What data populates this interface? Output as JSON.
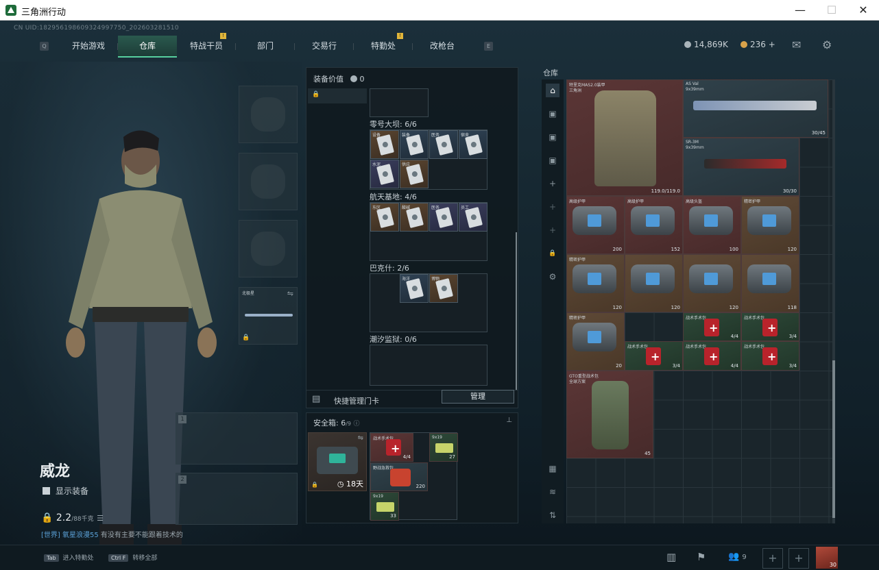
{
  "window": {
    "title": "三角洲行动",
    "min": "—",
    "max": "☐",
    "close": "✕"
  },
  "uid": "CN UID:182956198609324997750_202603281510",
  "nav": {
    "left_key": "Q",
    "right_key": "E",
    "tabs": [
      {
        "label": "开始游戏",
        "active": false,
        "badge": ""
      },
      {
        "label": "仓库",
        "active": true,
        "badge": ""
      },
      {
        "label": "特战干员",
        "active": false,
        "badge": "!"
      },
      {
        "label": "部门",
        "active": false,
        "badge": ""
      },
      {
        "label": "交易行",
        "active": false,
        "badge": ""
      },
      {
        "label": "特勤处",
        "active": false,
        "badge": "!"
      },
      {
        "label": "改枪台",
        "active": false,
        "badge": ""
      }
    ]
  },
  "currency": {
    "coins": "14,869K",
    "premium": "236 +"
  },
  "character": {
    "name": "威龙",
    "show_equipment": "显示装备",
    "weight": "2.2",
    "weight_unit": "/88千克",
    "melee_label": "北极星"
  },
  "chat": {
    "channel": "[世界]",
    "user": "氧星浪漫55",
    "text": "有没有主要不能跟着技术的"
  },
  "bottom": {
    "hint1_key": "Tab",
    "hint1": "进入特勤处",
    "hint2_key": "Ctrl F",
    "hint2": "转移全部",
    "friends": "9",
    "avatar_badge": "30"
  },
  "equip": {
    "title": "装备价值",
    "value": "0",
    "sections": [
      {
        "label": "零号大坝: 6/6"
      },
      {
        "label": "航天基地: 4/6"
      },
      {
        "label": "巴克什: 2/6"
      },
      {
        "label": "潮汐监狱: 0/6"
      }
    ],
    "cards_row1": [
      "设备",
      "装备",
      "医务",
      "宿舍"
    ],
    "cards_row2": [
      "水泥",
      "供应"
    ],
    "cards_row3": [
      "东区",
      "酸碱",
      "医务",
      "员工"
    ],
    "cards_row4": [
      "海洋",
      "博物"
    ],
    "keycard_label": "快捷管理门卡",
    "manage": "管理"
  },
  "safebox": {
    "title": "安全箱:",
    "count": "6",
    "cap": "/9",
    "timer": "18天",
    "items": [
      {
        "name": "战术手术包",
        "count": "4/4"
      },
      {
        "name": "9x19",
        "count": "27"
      },
      {
        "name": "野战急救包",
        "count": "220"
      },
      {
        "name": "9x19",
        "count": "33"
      }
    ]
  },
  "warehouse": {
    "title": "仓库",
    "items": [
      {
        "name": "特里克MAS2.0装甲",
        "sub": "三角洲",
        "count": "119.0/119.0",
        "color": "red"
      },
      {
        "name": "AS Val",
        "sub": "9x39mm",
        "count": "30/45",
        "color": "gray"
      },
      {
        "name": "SR-3M",
        "sub": "9x39mm",
        "count": "30/30",
        "color": "gray"
      },
      {
        "name": "高级护甲",
        "count": "200",
        "color": "red"
      },
      {
        "name": "高级护甲",
        "count": "152",
        "color": "red"
      },
      {
        "name": "高级头盔",
        "count": "100",
        "color": "red"
      },
      {
        "name": "精密护甲",
        "count": "120",
        "color": "gold"
      },
      {
        "name": "精密护甲",
        "count": "120",
        "color": "gold"
      },
      {
        "name": "",
        "count": "120",
        "color": "gold"
      },
      {
        "name": "",
        "count": "120",
        "color": "gold"
      },
      {
        "name": "",
        "count": "118",
        "color": "gold"
      },
      {
        "name": "精密护甲",
        "count": "20",
        "color": "gold"
      },
      {
        "name": "战术手术包",
        "count": "4/4",
        "color": "green"
      },
      {
        "name": "战术手术包",
        "count": "3/4",
        "color": "green"
      },
      {
        "name": "战术手术包",
        "count": "3/4",
        "color": "green"
      },
      {
        "name": "战术手术包",
        "count": "4/4",
        "color": "green"
      },
      {
        "name": "战术手术包",
        "count": "3/4",
        "color": "green"
      },
      {
        "name": "GTO重型战术包",
        "sub": "全球方案",
        "count": "45",
        "color": "red"
      }
    ]
  }
}
